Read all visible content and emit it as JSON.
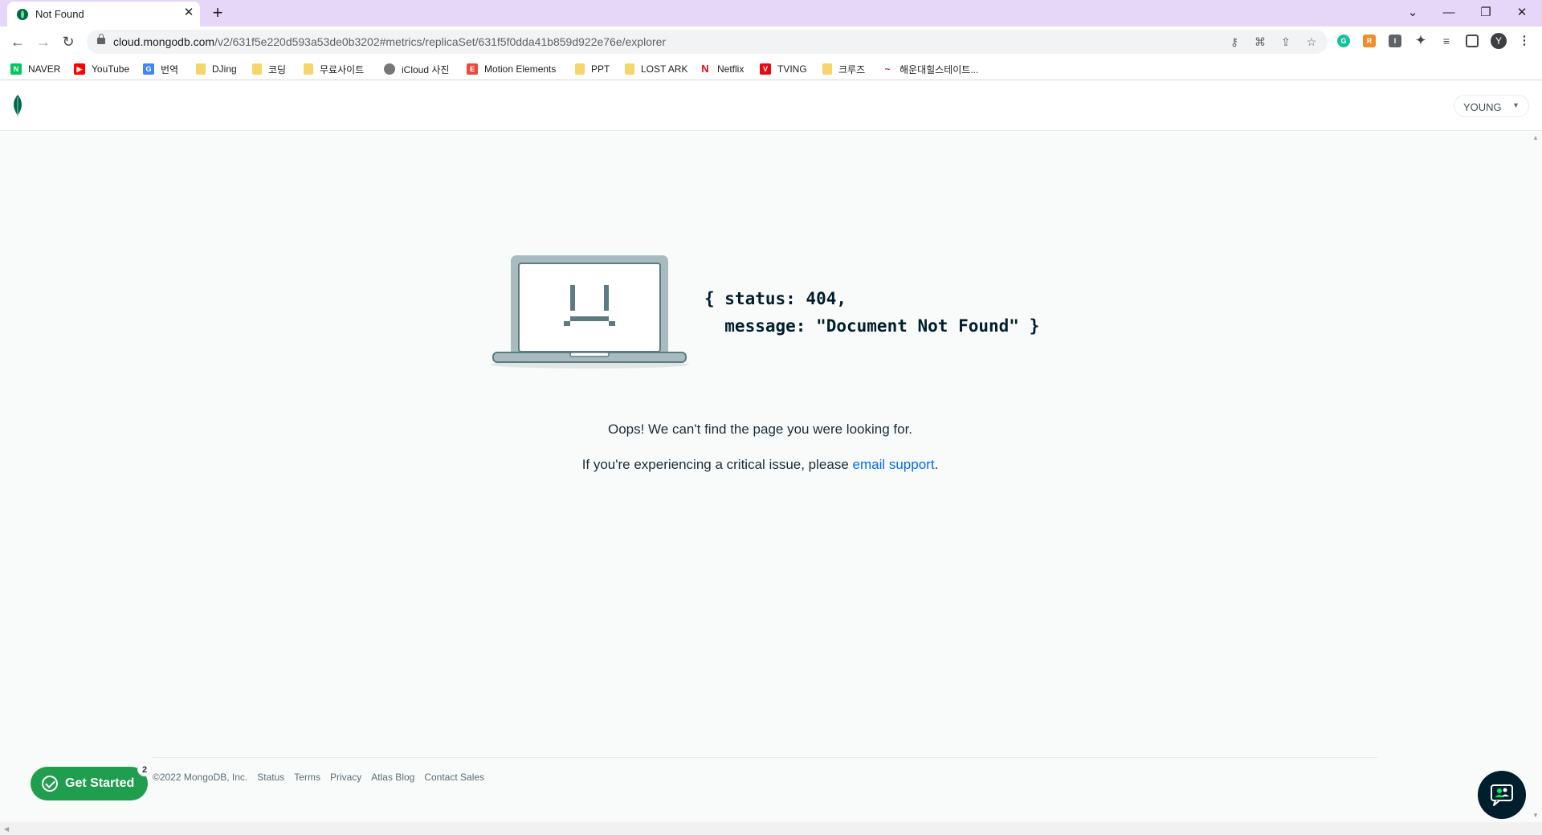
{
  "browser": {
    "tab_title": "Not Found",
    "tab_close": "✕",
    "new_tab": "+",
    "url_host": "cloud.mongodb.com",
    "url_path": "/v2/631f5e220d593a53de0b3202#metrics/replicaSet/631f5f0dda41b859d922e76e/explorer",
    "profile_initial": "Y",
    "window_controls": {
      "menu": "⌄",
      "minimize": "—",
      "restore": "❐",
      "close": "✕"
    }
  },
  "bookmarks": [
    {
      "label": "NAVER",
      "icon": "naver-icon",
      "color": "#03c75a",
      "glyph": "N"
    },
    {
      "label": "YouTube",
      "icon": "youtube-icon",
      "color": "#ff0000",
      "glyph": "▶"
    },
    {
      "label": "번역",
      "icon": "translate-icon",
      "color": "#4285f4",
      "glyph": "G"
    },
    {
      "label": "DJing",
      "icon": "folder-icon"
    },
    {
      "label": "코딩",
      "icon": "folder-icon"
    },
    {
      "label": "무료사이트",
      "icon": "folder-icon"
    },
    {
      "label": "iCloud 사진",
      "icon": "apple-icon",
      "color": "#555555",
      "glyph": ""
    },
    {
      "label": "Motion Elements",
      "icon": "motion-elements-icon",
      "color": "#e84c3d",
      "glyph": "E"
    },
    {
      "label": "PPT",
      "icon": "folder-icon"
    },
    {
      "label": "LOST ARK",
      "icon": "folder-icon"
    },
    {
      "label": "Netflix",
      "icon": "netflix-icon",
      "color": "#e50914",
      "glyph": "N"
    },
    {
      "label": "TVING",
      "icon": "tving-icon",
      "color": "#e50914",
      "glyph": "V"
    },
    {
      "label": "크루즈",
      "icon": "folder-icon"
    },
    {
      "label": "해운대힐스테이트...",
      "icon": "hillstate-icon",
      "color": "#d0243c",
      "glyph": "~"
    }
  ],
  "header": {
    "user_label": "YOUNG",
    "caret": "▼"
  },
  "error": {
    "code_line1": "{ status: 404,",
    "code_line2": "  message: \"Document Not Found\" }",
    "message1": "Oops! We can't find the page you were looking for.",
    "message2_prefix": "If you're experiencing a critical issue, please ",
    "message2_link": "email support",
    "message2_suffix": "."
  },
  "footer": {
    "copyright": "©2022 MongoDB, Inc.",
    "links": [
      "Status",
      "Terms",
      "Privacy",
      "Atlas Blog",
      "Contact Sales"
    ]
  },
  "get_started": {
    "label": "Get Started",
    "badge": "2"
  },
  "colors": {
    "brand_green": "#00684a",
    "cta_green": "#1f9e4d",
    "link_blue": "#016bf8",
    "chrome_tabstrip": "#e6d6f7"
  }
}
